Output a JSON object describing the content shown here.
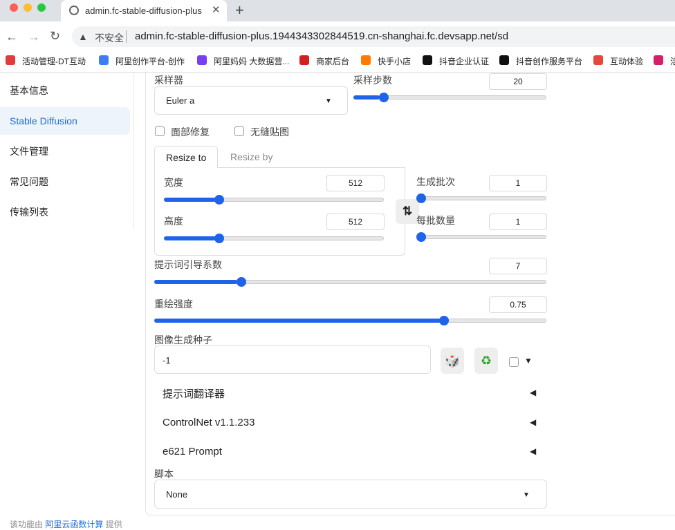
{
  "browser": {
    "tab_title": "admin.fc-stable-diffusion-plus",
    "insecure_label": "不安全",
    "url": "admin.fc-stable-diffusion-plus.1944343302844519.cn-shanghai.fc.devsapp.net/sd",
    "bookmarks": [
      {
        "label": "活动管理-DT互动",
        "color": "#e33b3b"
      },
      {
        "label": "阿里创作平台-创作",
        "color": "#3e7cf2"
      },
      {
        "label": "阿里妈妈 大数据营...",
        "color": "#7b3ff2"
      },
      {
        "label": "商家后台",
        "color": "#d41f1f"
      },
      {
        "label": "快手小店",
        "color": "#ff7a00"
      },
      {
        "label": "抖音企业认证",
        "color": "#111111"
      },
      {
        "label": "抖音创作服务平台",
        "color": "#111111"
      },
      {
        "label": "互动体验",
        "color": "#e3483b"
      },
      {
        "label": "活",
        "color": "#d41f6b"
      }
    ]
  },
  "sidebar": {
    "items": [
      "基本信息",
      "Stable Diffusion",
      "文件管理",
      "常见问题",
      "传输列表"
    ],
    "active_index": 1
  },
  "form": {
    "sampler_label": "采样器",
    "sampler_value": "Euler a",
    "steps_label": "采样步数",
    "steps_value": "20",
    "steps_fraction": 0.14,
    "face_restore_label": "面部修复",
    "tiling_label": "无缝贴图",
    "resize_tabs": [
      "Resize to",
      "Resize by"
    ],
    "width_label": "宽度",
    "width_value": "512",
    "width_fraction": 0.24,
    "height_label": "高度",
    "height_value": "512",
    "height_fraction": 0.24,
    "swap_icon": "⇅",
    "batch_count_label": "生成批次",
    "batch_count_value": "1",
    "batch_count_fraction": 0.0,
    "batch_size_label": "每批数量",
    "batch_size_value": "1",
    "batch_size_fraction": 0.0,
    "cfg_label": "提示词引导系数",
    "cfg_value": "7",
    "cfg_fraction": 0.215,
    "denoise_label": "重绘强度",
    "denoise_value": "0.75",
    "denoise_fraction": 0.745,
    "seed_label": "图像生成种子",
    "seed_value": "-1",
    "dice_icon": "🎲",
    "recycle_icon": "♻",
    "extra_toggle": "▼",
    "accordions": [
      {
        "title": "提示词翻译器",
        "arrow": "◀"
      },
      {
        "title": "ControlNet v1.1.233",
        "arrow": "◀"
      },
      {
        "title": "e621 Prompt",
        "arrow": "◀"
      }
    ],
    "script_label": "脚本",
    "script_value": "None"
  },
  "footer": {
    "prefix": "该功能由",
    "link": "阿里云函数计算",
    "suffix": "提供"
  }
}
